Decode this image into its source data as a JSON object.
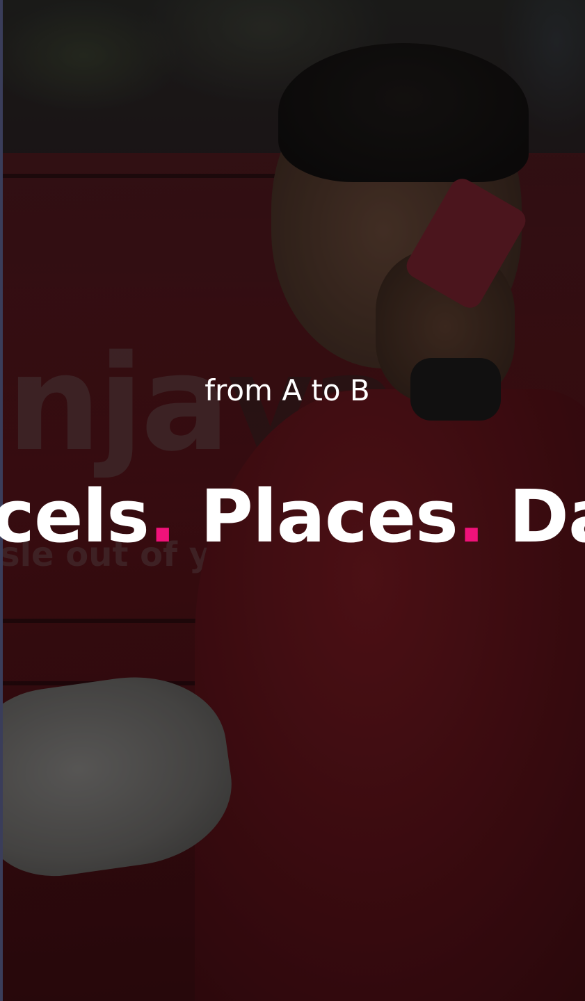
{
  "hero": {
    "kicker": "from A to B",
    "headline": {
      "words": [
        "rcels",
        "Places",
        "Da"
      ],
      "separator": "."
    },
    "accent_color": "#f0127a",
    "background": "photo of smiling courier in red polo on a phone, holding a parcel in front of red van",
    "van_brand_fragment": "nja",
    "van_brand_fragment_2": "va",
    "van_tagline_fragment": "sle out of you"
  }
}
